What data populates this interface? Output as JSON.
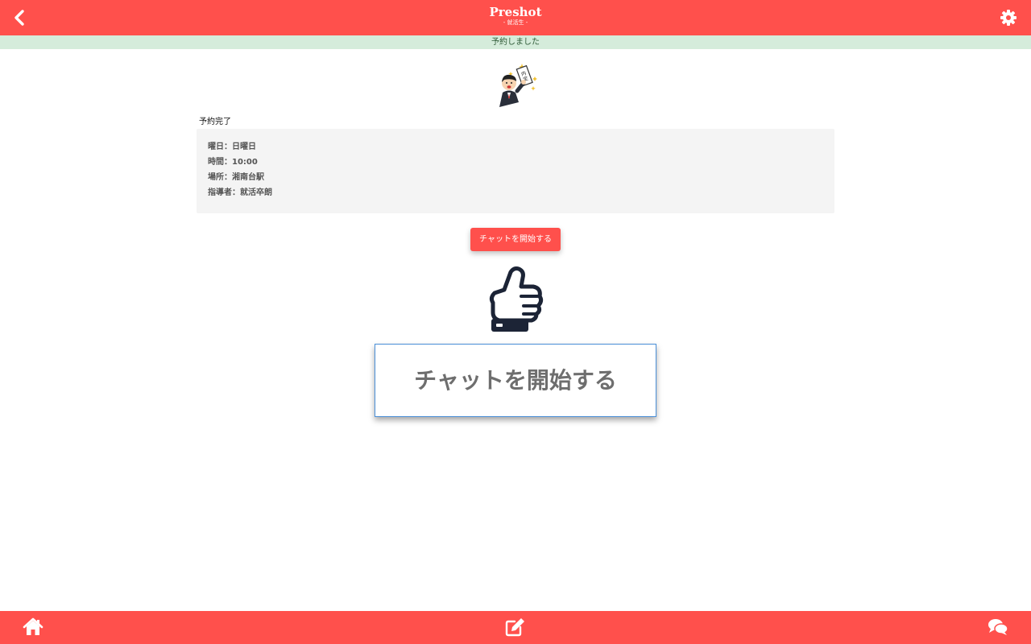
{
  "header": {
    "title": "Preshot",
    "subtitle": "- 就活生 -",
    "back_icon": "chevron-left-icon",
    "settings_icon": "gear-icon"
  },
  "notice": {
    "message": "予約しました"
  },
  "reservation": {
    "heading": "予約完了",
    "illustration": "businessman-with-job-offer-illustration",
    "details": [
      "曜日：日曜日",
      "時間：10:00",
      "場所：湘南台駅",
      "指導者：就活卒朗"
    ]
  },
  "actions": {
    "start_chat_label": "チャットを開始する",
    "pointer_icon": "pointing-hand-icon",
    "zoomed_label": "チャットを開始する"
  },
  "footer": {
    "items": [
      "home-icon",
      "edit-icon",
      "chat-icon"
    ]
  },
  "colors": {
    "brand": "#ff504c",
    "notice_bg": "#d5ecdb",
    "notice_text": "#2e5a36",
    "detail_bg": "#f4f4f4",
    "highlight_border": "#4a8fd8"
  }
}
